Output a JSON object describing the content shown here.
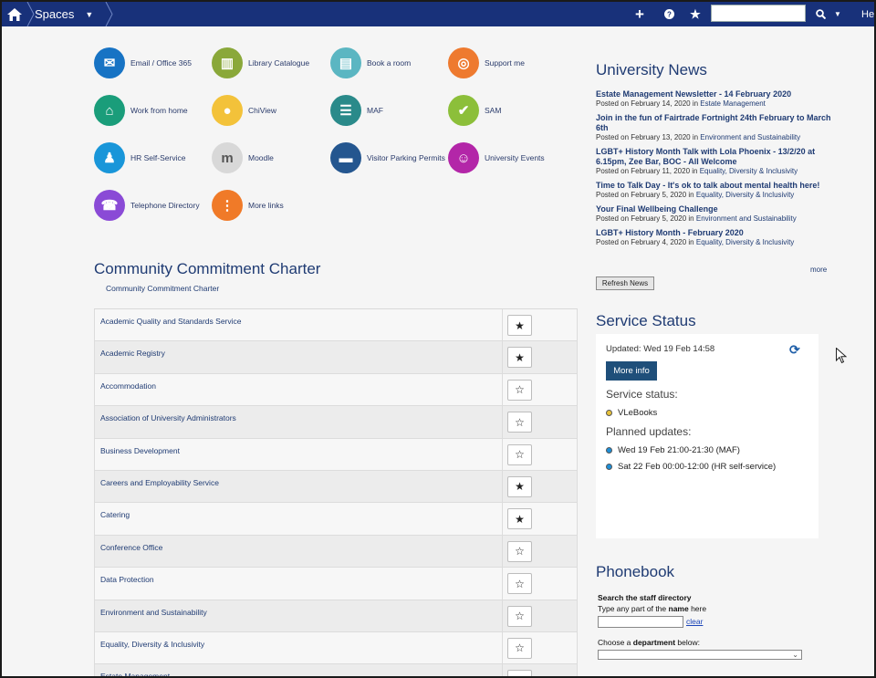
{
  "topbar": {
    "spaces_label": "Spaces",
    "help_label": "Hel",
    "search_placeholder": "",
    "icons": [
      "home-icon",
      "plus-icon",
      "help-icon",
      "star-icon",
      "search-icon"
    ]
  },
  "quick_links": [
    {
      "label": "Email / Office 365",
      "icon": "outlook-icon",
      "color": "#1773c4",
      "glyph": "✉"
    },
    {
      "label": "Library Catalogue",
      "icon": "books-icon",
      "color": "#8aa83a",
      "glyph": "▥"
    },
    {
      "label": "Book a room",
      "icon": "room-icon",
      "color": "#5bb6c2",
      "glyph": "▤"
    },
    {
      "label": "Support me",
      "icon": "lifebuoy-icon",
      "color": "#ee7a2f",
      "glyph": "◎"
    },
    {
      "label": "Work from home",
      "icon": "house-icon",
      "color": "#1a9d7a",
      "glyph": "⌂"
    },
    {
      "label": "ChiView",
      "icon": "person-icon",
      "color": "#f3c23a",
      "glyph": "●"
    },
    {
      "label": "MAF",
      "icon": "grades-icon",
      "color": "#2a8a8a",
      "glyph": "☰"
    },
    {
      "label": "SAM",
      "icon": "check-icon",
      "color": "#8cbf3a",
      "glyph": "✔"
    },
    {
      "label": "HR Self-Service",
      "icon": "staff-icon",
      "color": "#1996d9",
      "glyph": "♟"
    },
    {
      "label": "Moodle",
      "icon": "moodle-icon",
      "color": "#d8d8d8",
      "glyph": "m"
    },
    {
      "label": "Visitor Parking Permits",
      "icon": "car-icon",
      "color": "#24568f",
      "glyph": "▬"
    },
    {
      "label": "University Events",
      "icon": "events-icon",
      "color": "#b326a8",
      "glyph": "☺"
    },
    {
      "label": "Telephone Directory",
      "icon": "phonebook-icon",
      "color": "#8a4ad6",
      "glyph": "☎"
    },
    {
      "label": "More links",
      "icon": "more-icon",
      "color": "#f07a28",
      "glyph": "⋮"
    }
  ],
  "charter": {
    "title": "Community Commitment Charter",
    "subtitle": "Community Commitment Charter",
    "rows": [
      {
        "name": "Academic Quality and Standards Service",
        "star": "★"
      },
      {
        "name": "Academic Registry",
        "star": "★"
      },
      {
        "name": "Accommodation",
        "star": "☆"
      },
      {
        "name": "Association of University Administrators",
        "star": "☆"
      },
      {
        "name": "Business Development",
        "star": "☆"
      },
      {
        "name": "Careers and Employability Service",
        "star": "★"
      },
      {
        "name": "Catering",
        "star": "★"
      },
      {
        "name": "Conference Office",
        "star": "☆"
      },
      {
        "name": "Data Protection",
        "star": "☆"
      },
      {
        "name": "Environment and Sustainability",
        "star": "☆"
      },
      {
        "name": "Equality, Diversity & Inclusivity",
        "star": "☆"
      },
      {
        "name": "Estate Management",
        "star": "☆"
      }
    ]
  },
  "news": {
    "title": "University News",
    "items": [
      {
        "title": "Estate Management Newsletter - 14 February 2020",
        "posted": "Posted on February 14, 2020 in",
        "category": "Estate Management"
      },
      {
        "title": "Join in the fun of Fairtrade Fortnight 24th February to March 6th",
        "posted": "Posted on February 13, 2020 in",
        "category": "Environment and Sustainability"
      },
      {
        "title": "LGBT+ History Month Talk with Lola Phoenix - 13/2/20 at 6.15pm, Zee Bar, BOC - All Welcome",
        "posted": "Posted on February 11, 2020 in",
        "category": "Equality, Diversity & Inclusivity"
      },
      {
        "title": "Time to Talk Day - It's ok to talk about mental health here!",
        "posted": "Posted on February 5, 2020 in",
        "category": "Equality, Diversity & Inclusivity"
      },
      {
        "title": "Your Final Wellbeing Challenge",
        "posted": "Posted on February 5, 2020 in",
        "category": "Environment and Sustainability"
      },
      {
        "title": "LGBT+ History Month - February 2020",
        "posted": "Posted on February 4, 2020 in",
        "category": "Equality, Diversity & Inclusivity"
      }
    ],
    "more": "more",
    "refresh": "Refresh News"
  },
  "service_status": {
    "title": "Service Status",
    "updated": "Updated: Wed 19 Feb 14:58",
    "more_info": "More info",
    "status_heading": "Service status:",
    "status_item": "VLeBooks",
    "status_color": "#e8c23a",
    "planned_heading": "Planned updates:",
    "planned": [
      "Wed 19 Feb 21:00-21:30 (MAF)",
      "Sat 22 Feb 00:00-12:00 (HR self-service)"
    ],
    "planned_color": "#1e8fd8"
  },
  "phonebook": {
    "title": "Phonebook",
    "search_heading": "Search the staff directory",
    "hint_pre": "Type any part of the ",
    "hint_bold": "name",
    "hint_post": " here",
    "clear": "clear",
    "dept_pre": "Choose a ",
    "dept_bold": "department",
    "dept_post": " below:"
  }
}
